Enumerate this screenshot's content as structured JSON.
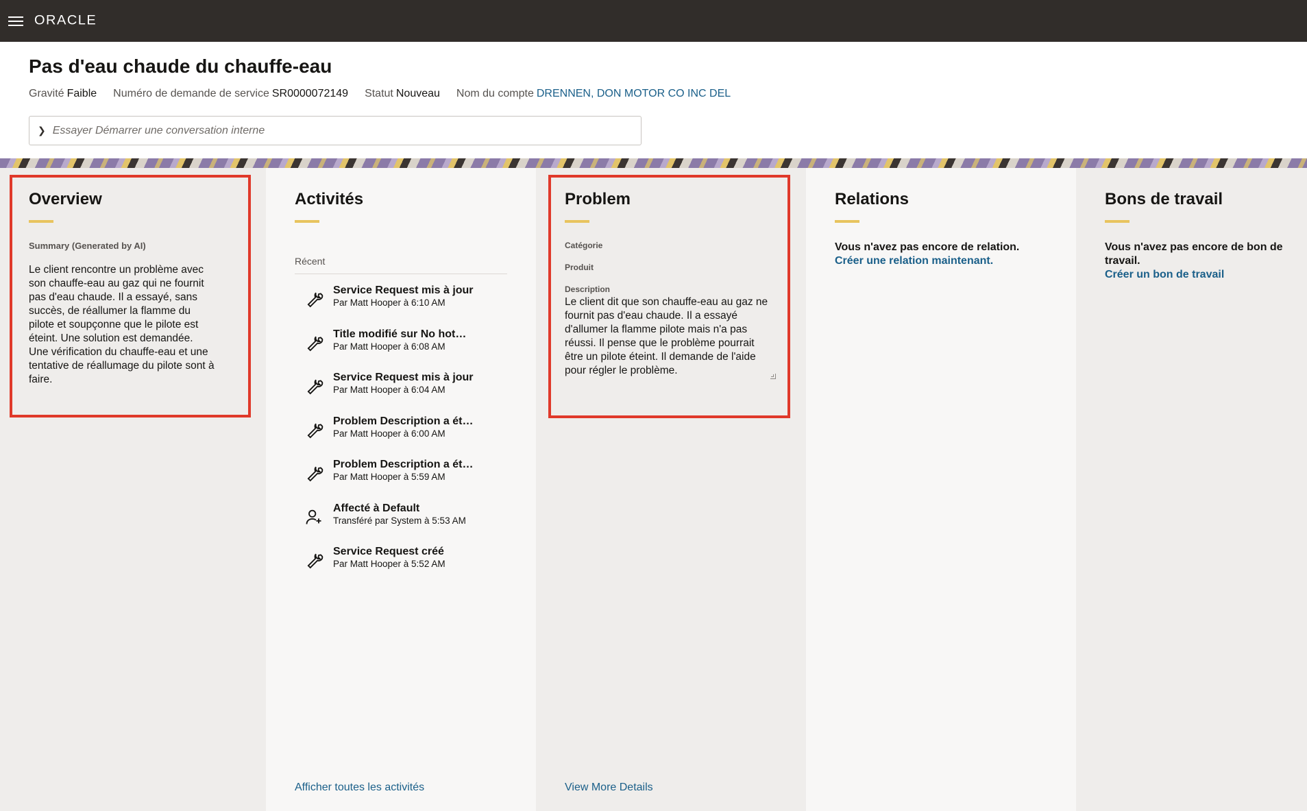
{
  "topbar": {
    "logo": "ORACLE"
  },
  "header": {
    "title": "Pas d'eau chaude du chauffe-eau",
    "gravite_label": "Gravité",
    "gravite_value": "Faible",
    "numero_label": "Numéro de demande de service",
    "numero_value": "SR0000072149",
    "statut_label": "Statut",
    "statut_value": "Nouveau",
    "compte_label": "Nom du compte",
    "compte_value": "DRENNEN, DON MOTOR CO INC DEL",
    "conversation_placeholder": "Essayer Démarrer une conversation interne"
  },
  "overview": {
    "title": "Overview",
    "summary_label": "Summary (Generated by AI)",
    "summary_text": "Le client rencontre un problème avec son chauffe-eau au gaz qui ne fournit pas d'eau chaude. Il a essayé, sans succès, de réallumer la flamme du pilote et soupçonne que le pilote est éteint. Une solution est demandée. Une vérification du chauffe-eau et une tentative de réallumage du pilote sont à faire."
  },
  "activities": {
    "title": "Activités",
    "recent_label": "Récent",
    "items": [
      {
        "icon": "wrench-icon",
        "title": "Service Request mis à jour",
        "sub": "Par Matt Hooper à 6:10 AM"
      },
      {
        "icon": "wrench-icon",
        "title": "Title modifié sur No hot…",
        "sub": "Par Matt Hooper à 6:08 AM"
      },
      {
        "icon": "wrench-icon",
        "title": "Service Request mis à jour",
        "sub": "Par Matt Hooper à 6:04 AM"
      },
      {
        "icon": "wrench-icon",
        "title": "Problem Description a été…",
        "sub": "Par Matt Hooper à 6:00 AM"
      },
      {
        "icon": "wrench-icon",
        "title": "Problem Description a été…",
        "sub": "Par Matt Hooper à 5:59 AM"
      },
      {
        "icon": "person-add-icon",
        "title": "Affecté à Default",
        "sub": "Transféré par System à 5:53 AM"
      },
      {
        "icon": "wrench-icon",
        "title": "Service Request créé",
        "sub": "Par Matt Hooper à 5:52 AM"
      }
    ],
    "view_all": "Afficher toutes les activités"
  },
  "problem": {
    "title": "Problem",
    "category_label": "Catégorie",
    "product_label": "Produit",
    "description_label": "Description",
    "description_text": "Le client dit que son chauffe-eau au gaz ne fournit pas d'eau chaude. Il a essayé d'allumer la flamme pilote mais n'a pas réussi. Il pense que le problème pourrait être un pilote éteint. Il demande de l'aide pour régler le problème.",
    "view_more": "View More Details"
  },
  "relations": {
    "title": "Relations",
    "empty_text": "Vous n'avez pas encore de relation.",
    "create_link": "Créer une relation maintenant."
  },
  "work_orders": {
    "title": "Bons de travail",
    "empty_text": "Vous n'avez pas encore de bon de travail.",
    "create_link": "Créer un bon de travail"
  },
  "colors": {
    "topbar": "#312d2a",
    "link": "#1a5f89",
    "accent": "#e8c45e",
    "highlight": "#e0392a"
  }
}
